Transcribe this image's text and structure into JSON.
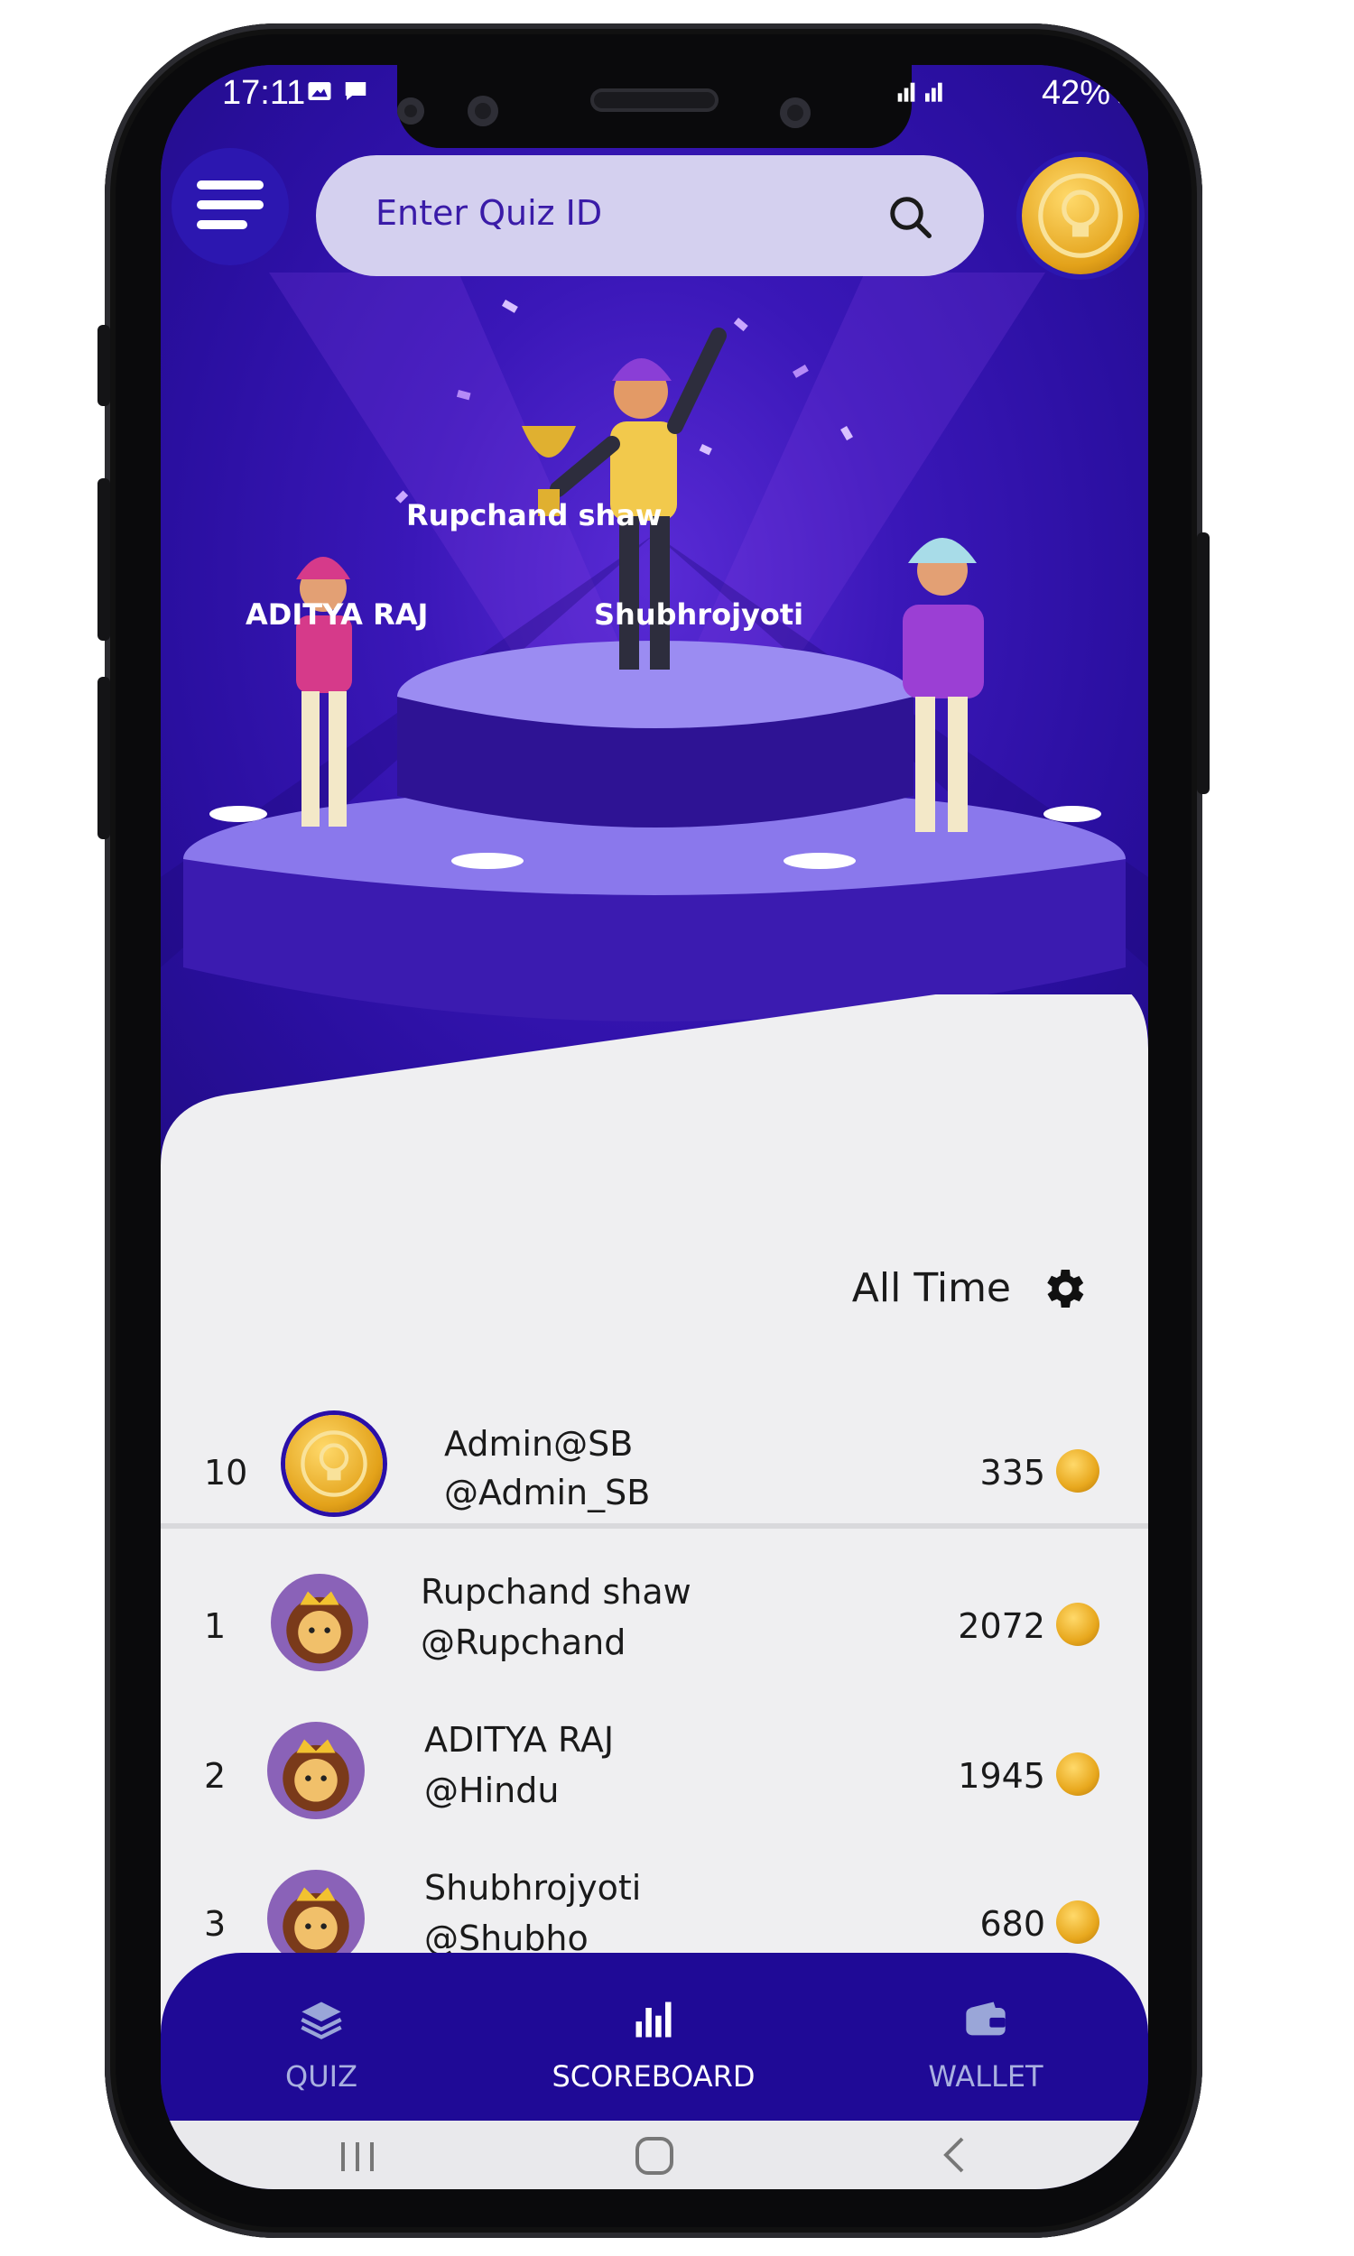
{
  "status_bar": {
    "time": "17:11",
    "signal_text": "R R",
    "battery": "42%"
  },
  "header": {
    "search_placeholder": "Enter Quiz ID"
  },
  "podium": {
    "first": "Rupchand shaw",
    "second": "ADITYA RAJ",
    "third": "Shubhrojyoti"
  },
  "leaderboard": {
    "filter_label": "All Time",
    "current_user": {
      "rank": "10",
      "name": "Admin@SB",
      "handle": "@Admin_SB",
      "score": "335"
    },
    "rows": [
      {
        "rank": "1",
        "name": "Rupchand shaw",
        "handle": "@Rupchand",
        "score": "2072"
      },
      {
        "rank": "2",
        "name": "ADITYA RAJ",
        "handle": "@Hindu",
        "score": "1945"
      },
      {
        "rank": "3",
        "name": "Shubhrojyoti",
        "handle": "@Shubho",
        "score": "680"
      }
    ]
  },
  "bottom_nav": {
    "items": [
      {
        "label": "QUIZ",
        "icon": "layers-icon",
        "active": false
      },
      {
        "label": "SCOREBOARD",
        "icon": "bar-chart-icon",
        "active": true
      },
      {
        "label": "WALLET",
        "icon": "wallet-icon",
        "active": false
      }
    ]
  },
  "colors": {
    "primary": "#2a0fa8",
    "nav": "#1f0a96",
    "card": "#efeff1",
    "coin": "#e8a81e"
  }
}
